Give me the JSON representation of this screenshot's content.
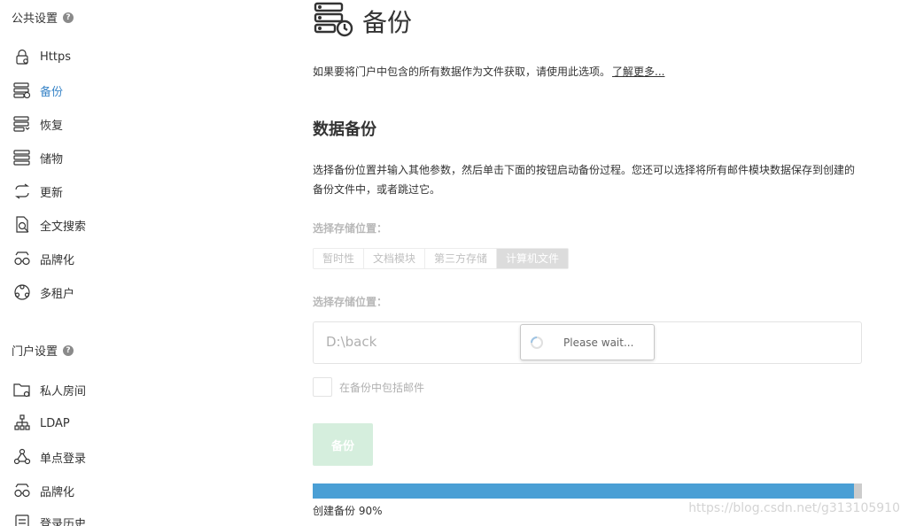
{
  "sidebar": {
    "public_settings": {
      "title": "公共设置",
      "help": "?"
    },
    "public_items": [
      {
        "label": "Https",
        "icon": "lock-certificate-icon",
        "active": false
      },
      {
        "label": "备份",
        "icon": "server-backup-icon",
        "active": true
      },
      {
        "label": "恢复",
        "icon": "server-restore-icon",
        "active": false
      },
      {
        "label": "储物",
        "icon": "server-storage-icon",
        "active": false
      },
      {
        "label": "更新",
        "icon": "refresh-arrows-icon",
        "active": false
      },
      {
        "label": "全文搜索",
        "icon": "document-search-icon",
        "active": false
      },
      {
        "label": "品牌化",
        "icon": "branding-glasses-icon",
        "active": false
      },
      {
        "label": "多租户",
        "icon": "multi-tenant-globe-icon",
        "active": false
      }
    ],
    "portal_settings": {
      "title": "门户设置",
      "help": "?"
    },
    "portal_items": [
      {
        "label": "私人房间",
        "icon": "private-room-folder-icon",
        "active": false
      },
      {
        "label": "LDAP",
        "icon": "ldap-tree-icon",
        "active": false
      },
      {
        "label": "单点登录",
        "icon": "sso-network-icon",
        "active": false
      },
      {
        "label": "品牌化",
        "icon": "branding-glasses-icon",
        "active": false
      },
      {
        "label": "登录历史",
        "icon": "login-history-icon",
        "active": false
      }
    ]
  },
  "main": {
    "title": "备份",
    "title_icon": "server-backup-clock-icon",
    "intro_text": "如果要将门户中包含的所有数据作为文件获取，请使用此选项。",
    "intro_link": "了解更多...",
    "section_title": "数据备份",
    "description": "选择备份位置并输入其他参数，然后单击下面的按钮启动备份过程。您还可以选择将所有邮件模块数据保存到创建的备份文件中，或者跳过它。",
    "storage_label": "选择存储位置：",
    "storage_tabs": [
      {
        "label": "暂时性",
        "active": false
      },
      {
        "label": "文档模块",
        "active": false
      },
      {
        "label": "第三方存储",
        "active": false
      },
      {
        "label": "计算机文件",
        "active": true
      }
    ],
    "path_label": "选择存储位置：",
    "path_value": "D:\\back",
    "wait_text": "Please wait...",
    "include_mail_label": "在备份中包括邮件",
    "include_mail_checked": false,
    "backup_button": "备份",
    "progress_percent": 0.985,
    "progress_text": "创建备份 90%"
  },
  "watermark": "https://blog.csdn.net/g313105910",
  "colors": {
    "accent": "#3b86c8",
    "progress": "#4a9fd5",
    "button_disabled": "#d5eedd"
  }
}
